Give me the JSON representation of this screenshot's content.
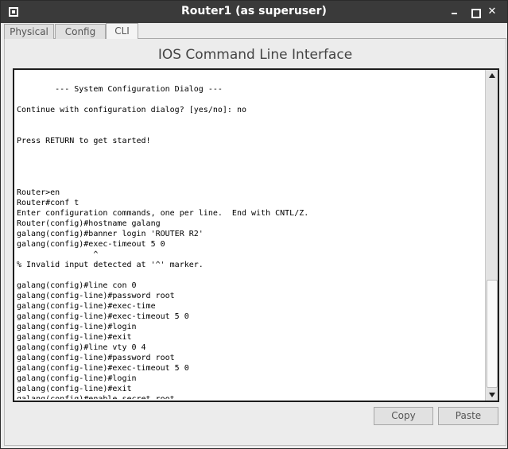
{
  "window": {
    "title": "Router1 (as superuser)",
    "icons": {
      "app": "app-menu-icon",
      "minimize": "minimize-icon",
      "maximize": "maximize-icon",
      "close": "close-icon"
    },
    "close_glyph": "✕"
  },
  "tabs": [
    {
      "label": "Physical"
    },
    {
      "label": "Config"
    },
    {
      "label": "CLI",
      "selected": true
    }
  ],
  "cli": {
    "heading": "IOS Command Line Interface",
    "console_text": "\n        --- System Configuration Dialog ---\n\nContinue with configuration dialog? [yes/no]: no\n\n\nPress RETURN to get started!\n\n\n\n\nRouter>en\nRouter#conf t\nEnter configuration commands, one per line.  End with CNTL/Z.\nRouter(config)#hostname galang\ngalang(config)#banner login 'ROUTER R2'\ngalang(config)#exec-timeout 5 0\n                ^\n% Invalid input detected at '^' marker.\n\ngalang(config)#line con 0\ngalang(config-line)#password root\ngalang(config-line)#exec-time\ngalang(config-line)#exec-timeout 5 0\ngalang(config-line)#login\ngalang(config-line)#exit\ngalang(config)#line vty 0 4\ngalang(config-line)#password root\ngalang(config-line)#exec-timeout 5 0\ngalang(config-line)#login\ngalang(config-line)#exit\ngalang(config)#enable secret root\ngalang(config)#",
    "scroll_position": 0.95
  },
  "buttons": {
    "copy": "Copy",
    "paste": "Paste"
  }
}
